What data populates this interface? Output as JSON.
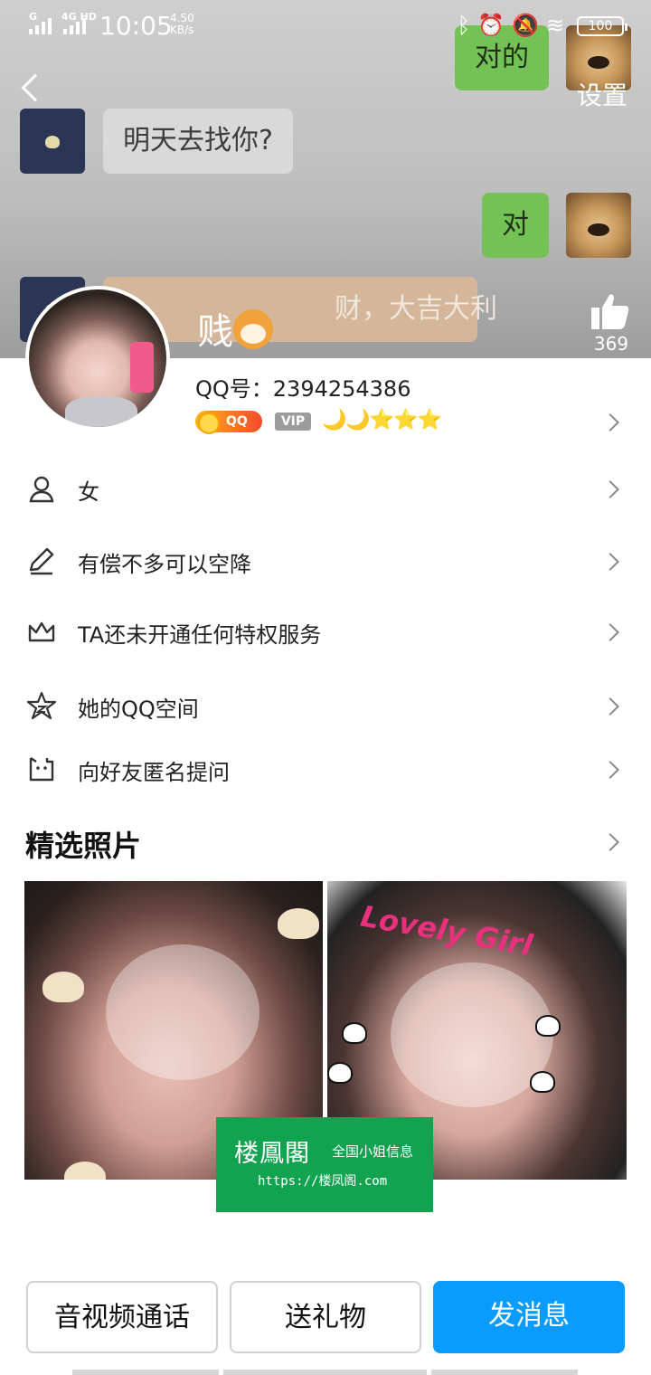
{
  "status_bar": {
    "signal_1": "G",
    "signal_2": "4G HD",
    "time": "10:05",
    "speed_value": "4.50",
    "speed_unit": "KB/s",
    "battery": "100"
  },
  "header": {
    "settings_label": "设置",
    "like_count": "369",
    "chat": [
      {
        "side": "out",
        "text": "对的"
      },
      {
        "side": "in",
        "text": "明天去找你?"
      },
      {
        "side": "out",
        "text": "对"
      },
      {
        "side": "in",
        "text": "财，大吉大利"
      }
    ]
  },
  "profile": {
    "nickname": "贱",
    "qq_number": "QQ号：2394254386",
    "qq_badge": "QQ",
    "vip_badge": "VIP",
    "level_icons": "🌙🌙⭐⭐⭐"
  },
  "rows": [
    {
      "icon": "person-icon",
      "label": "女"
    },
    {
      "icon": "pen-icon",
      "label": "有偿不多可以空降"
    },
    {
      "icon": "crown-icon",
      "label": "TA还未开通任何特权服务"
    },
    {
      "icon": "star-icon",
      "label": "她的QQ空间"
    },
    {
      "icon": "question-box-icon",
      "label": "向好友匿名提问"
    }
  ],
  "photos": {
    "title": "精选照片",
    "overlay_text": "Lovely Girl"
  },
  "watermark": {
    "title": "楼鳳閣",
    "subtitle": "全国小姐信息",
    "url": "https://楼凤阁.com"
  },
  "buttons": {
    "call": "音视频通话",
    "gift": "送礼物",
    "message": "发消息"
  }
}
